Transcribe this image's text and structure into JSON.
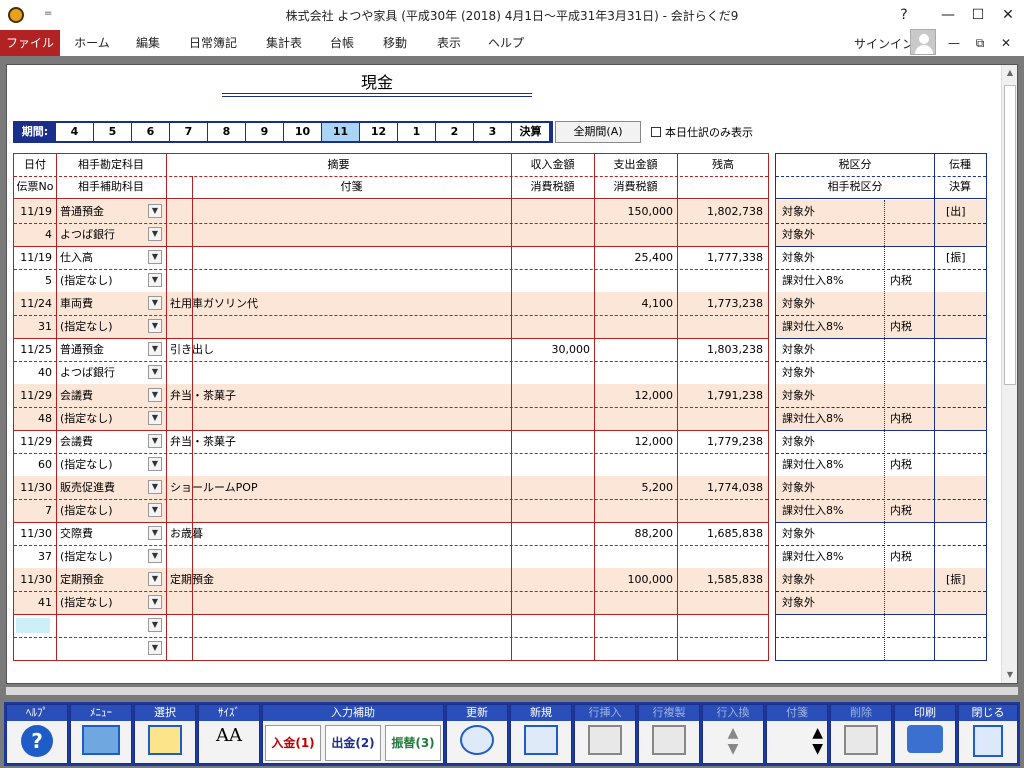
{
  "window": {
    "title": "株式会社 よつや家具 (平成30年 (2018) 4月1日～平成31年3月31日) - 会計らくだ9",
    "help": "?",
    "min": "—",
    "max": "☐",
    "close": "✕",
    "qa": "="
  },
  "menu": {
    "items": [
      "ファイル",
      "ホーム",
      "編集",
      "日常簿記",
      "集計表",
      "台帳",
      "移動",
      "表示",
      "ヘルプ"
    ],
    "signin": "サインイン",
    "sub_min": "—",
    "sub_restore": "⧉",
    "sub_close": "✕"
  },
  "sheet": {
    "title": "現金"
  },
  "period": {
    "label": "期間:",
    "months": [
      "4",
      "5",
      "6",
      "7",
      "8",
      "9",
      "10",
      "11",
      "12",
      "1",
      "2",
      "3"
    ],
    "selected": "11",
    "closing": "決算",
    "all_button": "全期間(A)",
    "today_only": "本日仕訳のみ表示"
  },
  "headers": {
    "row1": {
      "date": "日付",
      "account": "相手勘定科目",
      "summary": "摘要",
      "income": "収入金額",
      "expense": "支出金額",
      "balance": "残高",
      "tax": "税区分",
      "slip_type": "伝種"
    },
    "row2": {
      "slip_no": "伝票No",
      "sub_account": "相手補助科目",
      "tag": "付箋",
      "income_tax": "消費税額",
      "expense_tax": "消費税額",
      "counter_tax": "相手税区分",
      "closing": "決算"
    }
  },
  "entries": [
    {
      "date": "11/19",
      "account": "普通預金",
      "summary": "",
      "income": "",
      "expense": "150,000",
      "balance": "1,802,738",
      "tax": "対象外",
      "tax_incl": "",
      "slip_type": "[出]",
      "no": "4",
      "sub": "よつば銀行",
      "tax2": "対象外",
      "tax2_incl": ""
    },
    {
      "date": "11/19",
      "account": "仕入高",
      "summary": "",
      "income": "",
      "expense": "25,400",
      "balance": "1,777,338",
      "tax": "対象外",
      "tax_incl": "",
      "slip_type": "[振]",
      "no": "5",
      "sub": "(指定なし)",
      "tax2": "課対仕入8%",
      "tax2_incl": "内税"
    },
    {
      "date": "11/24",
      "account": "車両費",
      "summary": "社用車ガソリン代",
      "income": "",
      "expense": "4,100",
      "balance": "1,773,238",
      "tax": "対象外",
      "tax_incl": "",
      "slip_type": "",
      "no": "31",
      "sub": "(指定なし)",
      "tax2": "課対仕入8%",
      "tax2_incl": "内税"
    },
    {
      "date": "11/25",
      "account": "普通預金",
      "summary": "引き出し",
      "income": "30,000",
      "expense": "",
      "balance": "1,803,238",
      "tax": "対象外",
      "tax_incl": "",
      "slip_type": "",
      "no": "40",
      "sub": "よつば銀行",
      "tax2": "対象外",
      "tax2_incl": ""
    },
    {
      "date": "11/29",
      "account": "会議費",
      "summary": "弁当・茶菓子",
      "income": "",
      "expense": "12,000",
      "balance": "1,791,238",
      "tax": "対象外",
      "tax_incl": "",
      "slip_type": "",
      "no": "48",
      "sub": "(指定なし)",
      "tax2": "課対仕入8%",
      "tax2_incl": "内税"
    },
    {
      "date": "11/29",
      "account": "会議費",
      "summary": "弁当・茶菓子",
      "income": "",
      "expense": "12,000",
      "balance": "1,779,238",
      "tax": "対象外",
      "tax_incl": "",
      "slip_type": "",
      "no": "60",
      "sub": "(指定なし)",
      "tax2": "課対仕入8%",
      "tax2_incl": "内税"
    },
    {
      "date": "11/30",
      "account": "販売促進費",
      "summary": "ショールームPOP",
      "income": "",
      "expense": "5,200",
      "balance": "1,774,038",
      "tax": "対象外",
      "tax_incl": "",
      "slip_type": "",
      "no": "7",
      "sub": "(指定なし)",
      "tax2": "課対仕入8%",
      "tax2_incl": "内税"
    },
    {
      "date": "11/30",
      "account": "交際費",
      "summary": "お歳暮",
      "income": "",
      "expense": "88,200",
      "balance": "1,685,838",
      "tax": "対象外",
      "tax_incl": "",
      "slip_type": "",
      "no": "37",
      "sub": "(指定なし)",
      "tax2": "課対仕入8%",
      "tax2_incl": "内税"
    },
    {
      "date": "11/30",
      "account": "定期預金",
      "summary": "定期預金",
      "income": "",
      "expense": "100,000",
      "balance": "1,585,838",
      "tax": "対象外",
      "tax_incl": "",
      "slip_type": "[振]",
      "no": "41",
      "sub": "(指定なし)",
      "tax2": "対象外",
      "tax2_incl": ""
    }
  ],
  "toolbar": {
    "help": "ﾍﾙﾌﾟ",
    "menu": "ﾒﾆｭｰ",
    "select": "選択",
    "size": "ｻｲｽﾞ",
    "size_icon": "AA",
    "input_assist": "入力補助",
    "income_btn": "入金(1)",
    "expense_btn": "出金(2)",
    "transfer_btn": "振替(3)",
    "refresh": "更新",
    "new": "新規",
    "insert_row": "行挿入",
    "copy_row": "行複製",
    "swap_row": "行入換",
    "tag": "付箋",
    "delete": "削除",
    "print": "印刷",
    "close": "閉じる",
    "help_icon": "?"
  },
  "colors": {
    "accent_red": "#b22222",
    "accent_blue": "#1a2f8c",
    "row_pink": "#fbe6d7",
    "selected_month": "#a9d4f5"
  }
}
